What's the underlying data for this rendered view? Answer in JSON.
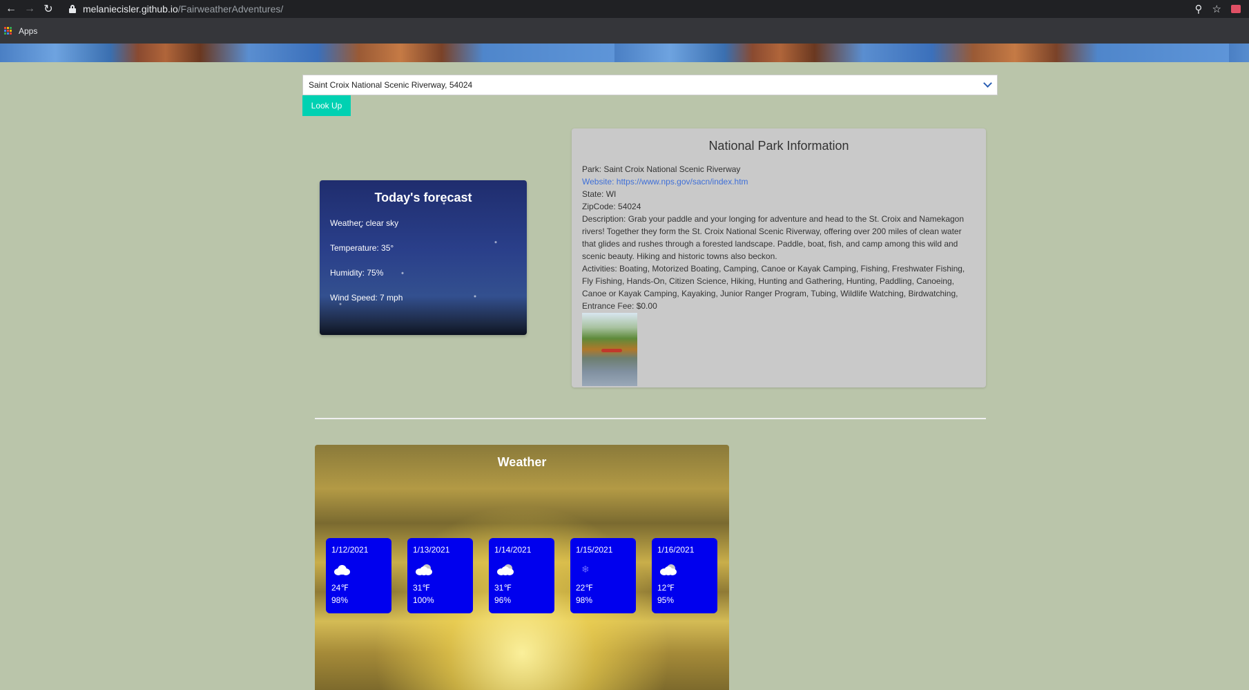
{
  "browser": {
    "url_host": "melaniecisler.github.io",
    "url_path": "/FairweatherAdventures/",
    "bookmarks_apps_label": "Apps"
  },
  "search": {
    "selected_value": "Saint Croix National Scenic Riverway, 54024",
    "button_label": "Look Up"
  },
  "forecast": {
    "title": "Today's forecast",
    "weather": "Weather: clear sky",
    "temperature": "Temperature: 35°",
    "humidity": "Humidity: 75%",
    "wind": "Wind Speed: 7 mph"
  },
  "park": {
    "title": "National Park Information",
    "park": "Park: Saint Croix National Scenic Riverway",
    "website": "Website: https://www.nps.gov/sacn/index.htm",
    "state": "State: WI",
    "zip": "ZipCode: 54024",
    "description": "Description: Grab your paddle and your longing for adventure and head to the St. Croix and Namekagon rivers! Together they form the St. Croix National Scenic Riverway, offering over 200 miles of clean water that glides and rushes through a forested landscape. Paddle, boat, fish, and camp among this wild and scenic beauty. Hiking and historic towns also beckon.",
    "activities": "Activities: Boating, Motorized Boating, Camping, Canoe or Kayak Camping, Fishing, Freshwater Fishing, Fly Fishing, Hands-On, Citizen Science, Hiking, Hunting and Gathering, Hunting, Paddling, Canoeing, Canoe or Kayak Camping, Kayaking, Junior Ranger Program, Tubing, Wildlife Watching, Birdwatching,",
    "fee": "Entrance Fee: $0.00"
  },
  "weather": {
    "title": "Weather",
    "days": [
      {
        "date": "1/12/2021",
        "icon": "cloud-icon",
        "temp": "24℉",
        "humidity": "98%"
      },
      {
        "date": "1/13/2021",
        "icon": "partly-cloudy-icon",
        "temp": "31℉",
        "humidity": "100%"
      },
      {
        "date": "1/14/2021",
        "icon": "partly-cloudy-icon",
        "temp": "31℉",
        "humidity": "96%"
      },
      {
        "date": "1/15/2021",
        "icon": "snow-icon",
        "temp": "22℉",
        "humidity": "98%"
      },
      {
        "date": "1/16/2021",
        "icon": "partly-cloudy-icon",
        "temp": "12℉",
        "humidity": "95%"
      }
    ]
  },
  "colors": {
    "page_bg": "#bac5aa",
    "button_accent": "#00d1b2",
    "day_card": "#0000ee",
    "link": "#3e6fd8"
  }
}
